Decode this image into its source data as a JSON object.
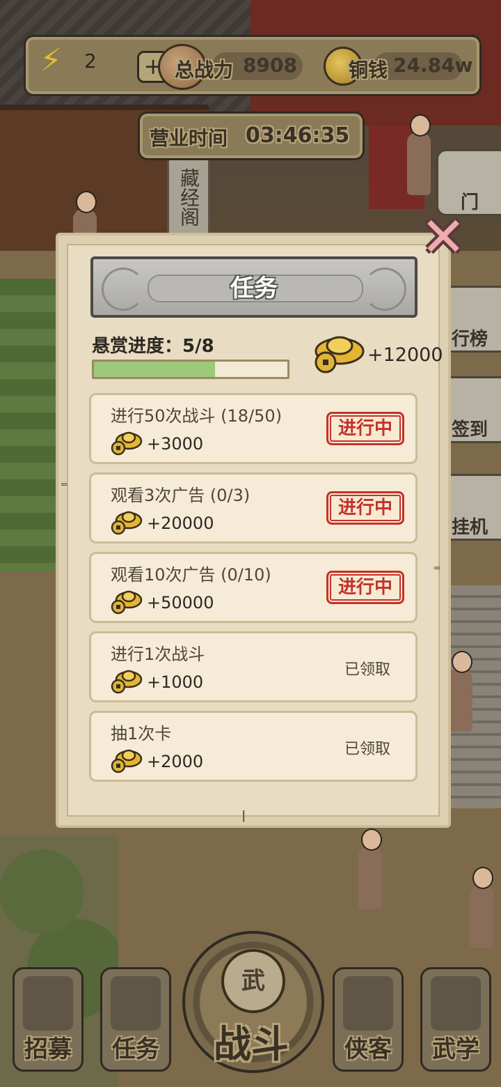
{
  "hud": {
    "energy": "2",
    "plus": "+",
    "power_label": "总战力",
    "power_value": "8908",
    "coin_label": "铜钱",
    "coin_value": "24.84w"
  },
  "business": {
    "label": "营业时间",
    "time": "03:46:35"
  },
  "background": {
    "plaque": "藏经阁",
    "side_buttons": [
      "门",
      "行榜",
      "签到",
      "挂机"
    ]
  },
  "modal": {
    "title": "任务",
    "close": "✕",
    "bounty_label": "悬赏进度：5/8",
    "bounty_progress": 0.625,
    "bounty_reward": "+12000",
    "tasks": [
      {
        "name": "进行50次战斗 (18/50)",
        "reward": "+3000",
        "status": "进行中",
        "state": "in_progress"
      },
      {
        "name": "观看3次广告 (0/3)",
        "reward": "+20000",
        "status": "进行中",
        "state": "in_progress"
      },
      {
        "name": "观看10次广告 (0/10)",
        "reward": "+50000",
        "status": "进行中",
        "state": "in_progress"
      },
      {
        "name": "进行1次战斗",
        "reward": "+1000",
        "status": "已领取",
        "state": "claimed"
      },
      {
        "name": "抽1次卡",
        "reward": "+2000",
        "status": "已领取",
        "state": "claimed"
      }
    ]
  },
  "nav": {
    "recruit": "招募",
    "tasks": "任务",
    "battle": "战斗",
    "battle_emblem": "武",
    "heroes": "侠客",
    "martial": "武学"
  },
  "colors": {
    "status_red": "#c5322b",
    "progress_green": "#9cc97a",
    "panel": "#e8dcc2"
  }
}
